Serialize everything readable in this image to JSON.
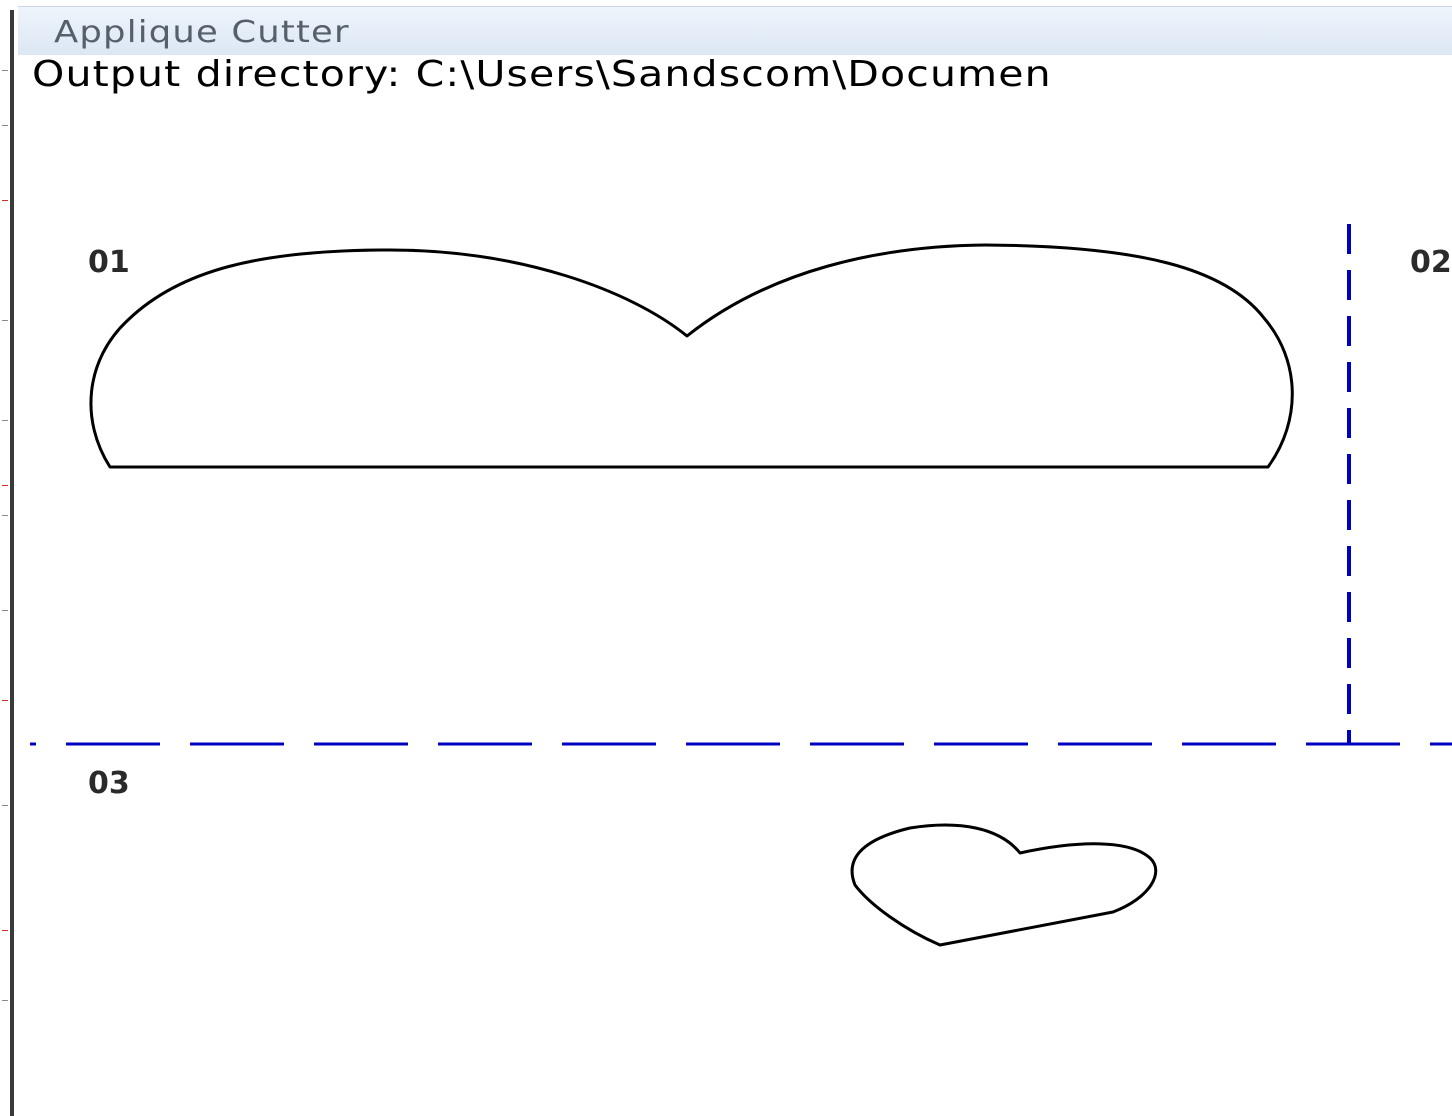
{
  "window": {
    "title": "Applique Cutter"
  },
  "output": {
    "label": "Output directory:",
    "path": "C:\\Users\\Sandscom\\Documen",
    "line": "Output directory: C:\\Users\\Sandscom\\Documen"
  },
  "pieces": [
    {
      "label": "01",
      "shape": "double-lobe-outline"
    },
    {
      "label": "02",
      "shape": "outline"
    },
    {
      "label": "03",
      "shape": "heart-outline"
    }
  ],
  "colors": {
    "divider": "#0000c0",
    "outline": "#000000",
    "title_text": "#55606c",
    "title_bar": "#dce7f4"
  },
  "icons": {
    "divider_style": "dashed-line"
  }
}
